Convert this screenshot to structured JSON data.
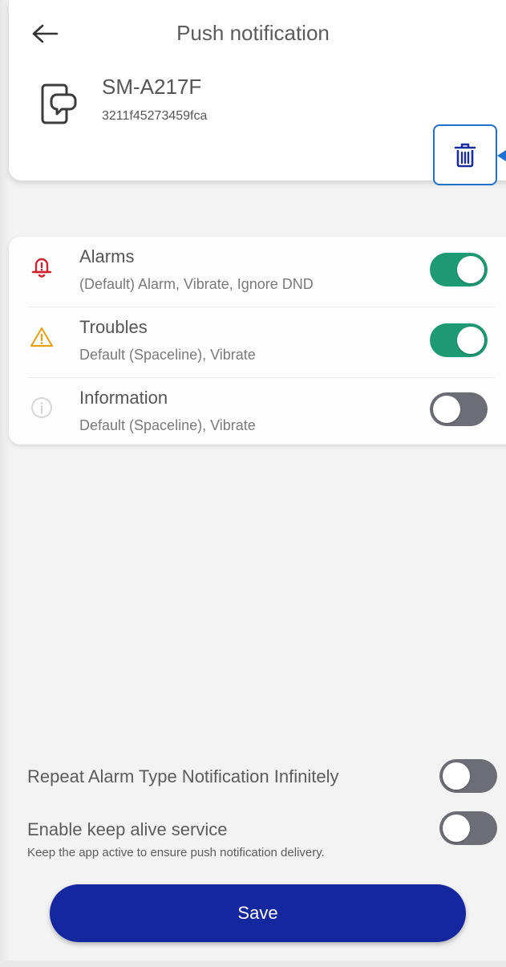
{
  "header": {
    "title": "Push notification",
    "back_icon": "arrow-left-icon"
  },
  "device": {
    "name": "SM-A217F",
    "id": "3211f45273459fca",
    "icon": "phone-chat-icon",
    "delete_icon": "trash-icon"
  },
  "notifications": [
    {
      "title": "Alarms",
      "subtitle": "(Default) Alarm, Vibrate, Ignore DND",
      "icon": "alarm-bell-icon",
      "icon_color": "#d0212f",
      "enabled": true
    },
    {
      "title": "Troubles",
      "subtitle": "Default (Spaceline), Vibrate",
      "icon": "warning-triangle-icon",
      "icon_color": "#e8a21a",
      "enabled": true
    },
    {
      "title": "Information",
      "subtitle": "Default (Spaceline), Vibrate",
      "icon": "info-circle-icon",
      "icon_color": "#d6d6d6",
      "enabled": false
    }
  ],
  "settings": {
    "repeat_label": "Repeat Alarm Type Notification Infinitely",
    "repeat_enabled": false,
    "keepalive_label": "Enable keep alive service",
    "keepalive_help": "Keep the app active to ensure push notification delivery.",
    "keepalive_enabled": false
  },
  "save_label": "Save",
  "colors": {
    "toggle_on": "#1e9a73",
    "toggle_off": "#6d6e75",
    "save_button": "#15279e",
    "delete_highlight": "#1e6fd0"
  }
}
